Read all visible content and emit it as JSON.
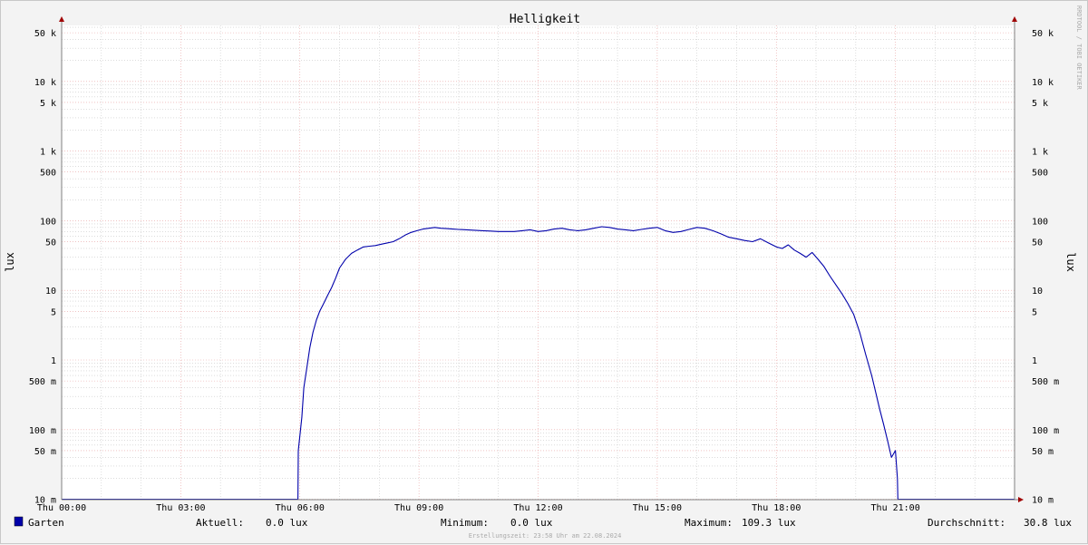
{
  "colors": {
    "plot_bg": "#ffffff",
    "canvas_bg": "#f3f3f3",
    "major_grid": "#e8a0a0",
    "minor_grid": "#c8c8c8",
    "series": "#0000aa",
    "axis": "#808080",
    "arrow": "#a00000"
  },
  "watermark": "RRDTOOL / TOBI OETIKER",
  "footer": {
    "creation": "Erstellungszeit: 23:58 Uhr am 22.08.2024"
  },
  "legend": {
    "series_name": "Garten",
    "current_label": "Aktuell:",
    "current_value": "0.0 lux",
    "min_label": "Minimum:",
    "min_value": "0.0 lux",
    "max_label": "Maximum:",
    "max_value": "109.3 lux",
    "avg_label": "Durchschnitt:",
    "avg_value": "30.8 lux"
  },
  "chart_data": {
    "type": "line",
    "title": "Helligkeit",
    "ylabel": "lux",
    "yscale": "log",
    "ylim": [
      0.01,
      80
    ],
    "xlim": [
      0,
      24
    ],
    "x_ticks": [
      {
        "x": 0,
        "label": "Thu 00:00"
      },
      {
        "x": 3,
        "label": "Thu 03:00"
      },
      {
        "x": 6,
        "label": "Thu 06:00"
      },
      {
        "x": 9,
        "label": "Thu 09:00"
      },
      {
        "x": 12,
        "label": "Thu 12:00"
      },
      {
        "x": 15,
        "label": "Thu 15:00"
      },
      {
        "x": 18,
        "label": "Thu 18:00"
      },
      {
        "x": 21,
        "label": "Thu 21:00"
      }
    ],
    "y_ticks": [
      {
        "v": 50000,
        "label": "50 k"
      },
      {
        "v": 10000,
        "label": "10 k"
      },
      {
        "v": 5000,
        "label": "5 k"
      },
      {
        "v": 1000,
        "label": "1 k"
      },
      {
        "v": 500,
        "label": "500"
      },
      {
        "v": 100,
        "label": "100"
      },
      {
        "v": 50,
        "label": "50"
      },
      {
        "v": 10,
        "label": "10"
      },
      {
        "v": 5,
        "label": "5"
      },
      {
        "v": 1,
        "label": "1"
      },
      {
        "v": 0.5,
        "label": "500 m"
      },
      {
        "v": 0.1,
        "label": "100 m"
      },
      {
        "v": 0.05,
        "label": "50 m"
      },
      {
        "v": 0.01,
        "label": "10 m"
      }
    ],
    "grid": true,
    "series": [
      {
        "name": "Garten",
        "x": [
          0,
          5.95,
          5.96,
          6.05,
          6.1,
          6.18,
          6.25,
          6.33,
          6.42,
          6.5,
          6.6,
          6.7,
          6.8,
          6.9,
          7.0,
          7.15,
          7.3,
          7.45,
          7.6,
          7.75,
          7.9,
          8.05,
          8.2,
          8.35,
          8.5,
          8.65,
          8.8,
          8.95,
          9.1,
          9.25,
          9.4,
          9.55,
          9.7,
          9.85,
          10.0,
          10.2,
          10.4,
          10.6,
          10.8,
          11.0,
          11.2,
          11.4,
          11.6,
          11.8,
          12.0,
          12.2,
          12.4,
          12.6,
          12.8,
          13.0,
          13.2,
          13.4,
          13.6,
          13.8,
          14.0,
          14.2,
          14.4,
          14.6,
          14.8,
          15.0,
          15.2,
          15.4,
          15.6,
          15.8,
          16.0,
          16.2,
          16.4,
          16.6,
          16.8,
          17.0,
          17.2,
          17.4,
          17.6,
          17.8,
          18.0,
          18.15,
          18.3,
          18.45,
          18.6,
          18.75,
          18.9,
          19.05,
          19.2,
          19.35,
          19.5,
          19.65,
          19.8,
          19.95,
          20.1,
          20.25,
          20.4,
          20.5,
          20.6,
          20.7,
          20.8,
          20.9,
          21.0,
          21.05,
          21.06,
          24
        ],
        "values": [
          0.01,
          0.01,
          0.05,
          0.15,
          0.4,
          0.8,
          1.5,
          2.5,
          3.8,
          5,
          6.5,
          8.5,
          11,
          15,
          21,
          28,
          34,
          38,
          42,
          43,
          44,
          46,
          48,
          50,
          55,
          62,
          68,
          72,
          76,
          78,
          80,
          78,
          77,
          76,
          75,
          74,
          73,
          72,
          71,
          70,
          70,
          70,
          72,
          74,
          70,
          72,
          76,
          78,
          74,
          72,
          74,
          78,
          82,
          80,
          76,
          74,
          72,
          75,
          78,
          80,
          72,
          68,
          70,
          75,
          80,
          78,
          72,
          65,
          58,
          55,
          52,
          50,
          55,
          48,
          42,
          40,
          45,
          38,
          34,
          30,
          35,
          28,
          22,
          16,
          12,
          9,
          6.5,
          4.5,
          2.5,
          1.2,
          0.6,
          0.35,
          0.2,
          0.12,
          0.07,
          0.04,
          0.05,
          0.02,
          0.01,
          0.01
        ]
      }
    ]
  }
}
